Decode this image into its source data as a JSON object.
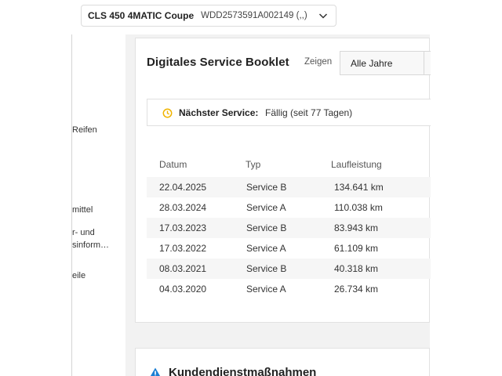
{
  "vehicle": {
    "model": "CLS 450 4MATIC Coupe",
    "vin": "WDD2573591A002149 (,,)"
  },
  "sidebar": {
    "items": [
      {
        "label": "Reifen"
      },
      {
        "label": "mittel"
      },
      {
        "label": "r- und"
      },
      {
        "label": "sinform…"
      },
      {
        "label": "eile"
      }
    ]
  },
  "booklet": {
    "title": "Digitales Service Booklet",
    "filter_label": "Zeigen",
    "filter_value": "Alle Jahre",
    "next_service_label": "Nächster Service:",
    "next_service_value": "Fällig (seit 77 Tagen)",
    "columns": {
      "date": "Datum",
      "type": "Typ",
      "mileage": "Laufleistung"
    },
    "rows": [
      {
        "date": "22.04.2025",
        "type": "Service B",
        "mileage": "134.641 km"
      },
      {
        "date": "28.03.2024",
        "type": "Service A",
        "mileage": "110.038 km"
      },
      {
        "date": "17.03.2023",
        "type": "Service B",
        "mileage": "83.943 km"
      },
      {
        "date": "17.03.2022",
        "type": "Service A",
        "mileage": "61.109 km"
      },
      {
        "date": "08.03.2021",
        "type": "Service B",
        "mileage": "40.318 km"
      },
      {
        "date": "04.03.2020",
        "type": "Service A",
        "mileage": "26.734 km"
      }
    ]
  },
  "customer_measures": {
    "title": "Kundendienstmaßnahmen"
  },
  "colors": {
    "accent_clock": "#f0b400",
    "warning": "#1c7fd4",
    "background": "#f2f2f2"
  },
  "icons": [
    "chevron-down-icon",
    "clock-icon",
    "warning-icon"
  ]
}
